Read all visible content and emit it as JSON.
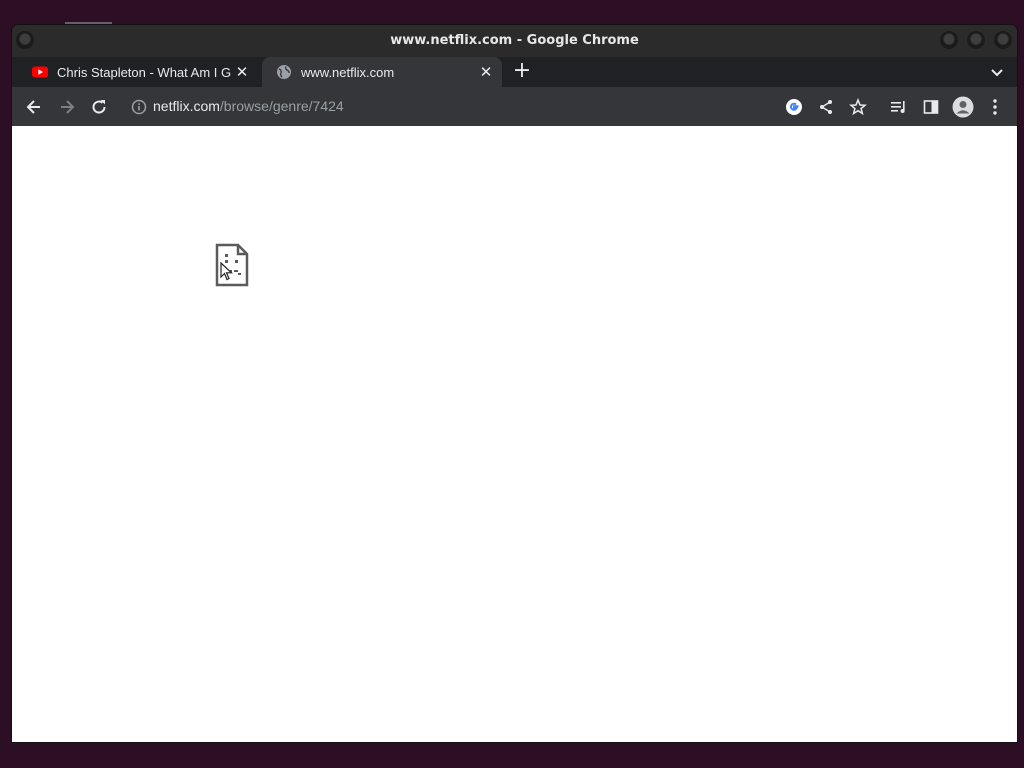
{
  "window": {
    "title": "www.netflix.com - Google Chrome"
  },
  "tabs": [
    {
      "label": "Chris Stapleton - What Am I G",
      "favicon": "youtube-icon",
      "close": "✕"
    },
    {
      "label": "www.netflix.com",
      "favicon": "globe-icon",
      "close": "✕",
      "active": true
    }
  ],
  "new_tab": "+",
  "address_bar": {
    "host": "netflix.com",
    "path": "/browse/genre/7424"
  },
  "colors": {
    "accent": "#35363a",
    "youtube_red": "#ff0000",
    "page_bg": "#ffffff"
  },
  "content": {
    "state": "broken-page-icon"
  }
}
